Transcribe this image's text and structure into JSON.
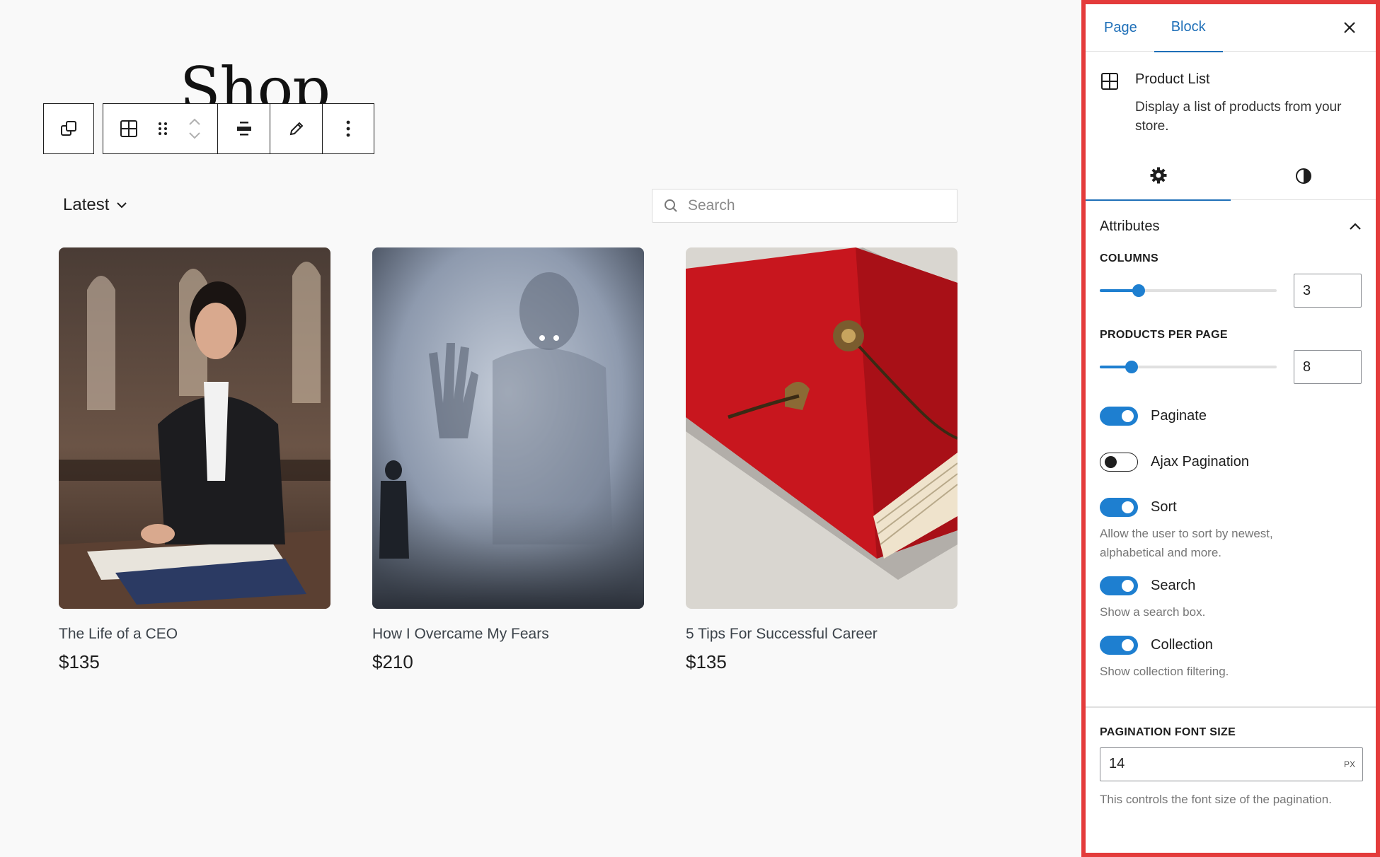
{
  "page": {
    "title": "Shop"
  },
  "toolbar": {
    "icons": [
      "duplicate-blocks-icon",
      "product-grid-icon",
      "drag-handle-icon",
      "move-up-icon",
      "move-down-icon",
      "align-center-icon",
      "edit-pencil-icon",
      "more-options-icon"
    ]
  },
  "catalog": {
    "sort_label": "Latest",
    "search_placeholder": "Search",
    "products": [
      {
        "name": "The Life of a CEO",
        "price": "$135"
      },
      {
        "name": "How I Overcame My Fears",
        "price": "$210"
      },
      {
        "name": "5 Tips For Successful Career",
        "price": "$135"
      }
    ]
  },
  "sidebar": {
    "tabs": {
      "page": "Page",
      "block": "Block",
      "active": "Block"
    },
    "block": {
      "title": "Product List",
      "description": "Display a list of products from your store."
    },
    "subtabs": {
      "settings_icon": "gear-icon",
      "styles_icon": "contrast-icon",
      "active": "settings"
    },
    "attributes": {
      "heading": "Attributes",
      "columns": {
        "label": "Columns",
        "value": "3",
        "level": 0.22
      },
      "products_per_page": {
        "label": "Products per page",
        "value": "8",
        "level": 0.18
      },
      "paginate": {
        "label": "Paginate",
        "on": true
      },
      "ajax_pagination": {
        "label": "Ajax Pagination",
        "on": false
      },
      "sort": {
        "label": "Sort",
        "on": true,
        "help": "Allow the user to sort by newest, alphabetical and more."
      },
      "search": {
        "label": "Search",
        "on": true,
        "help": "Show a search box."
      },
      "collection": {
        "label": "Collection",
        "on": true,
        "help": "Show collection filtering."
      },
      "pagination_font_size": {
        "label": "Pagination font size",
        "value": "14",
        "unit": "PX",
        "help": "This controls the font size of the pagination."
      }
    }
  },
  "colors": {
    "accent": "#1e7fd0",
    "tab_link": "#1e6fb8",
    "highlight_border": "#e43b3b"
  }
}
